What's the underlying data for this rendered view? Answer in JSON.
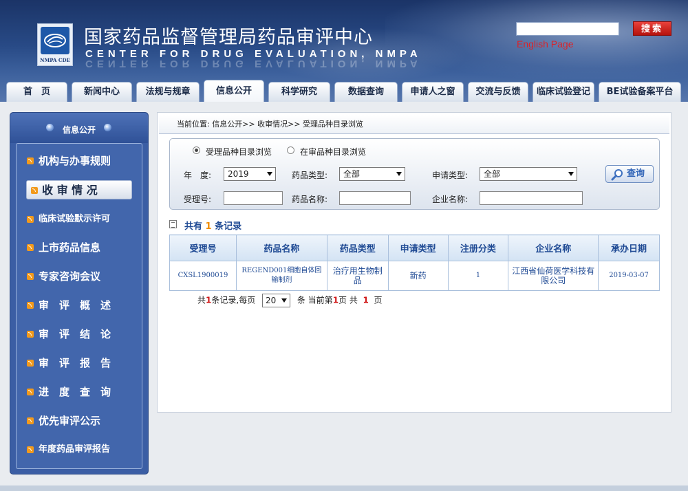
{
  "header": {
    "logo_text": "NMPA CDE",
    "title_cn": "国家药品监督管理局药品审评中心",
    "title_en": "CENTER FOR DRUG EVALUATION, NMPA",
    "search_button": "搜索",
    "search_placeholder": "",
    "english_link": "English Page"
  },
  "nav": {
    "tabs": [
      {
        "label": "首　页"
      },
      {
        "label": "新闻中心"
      },
      {
        "label": "法规与规章"
      },
      {
        "label": "信息公开",
        "active": true
      },
      {
        "label": "科学研究"
      },
      {
        "label": "数据查询"
      },
      {
        "label": "申请人之窗"
      },
      {
        "label": "交流与反馈"
      },
      {
        "label": "临床试验登记"
      },
      {
        "label": "BE试验备案平台"
      }
    ]
  },
  "sidebar": {
    "title": "信息公开",
    "items": [
      {
        "label": "机构与办事规则"
      },
      {
        "label": "收 审 情 况",
        "active": true
      },
      {
        "label": "临床试验默示许可"
      },
      {
        "label": "上市药品信息"
      },
      {
        "label": "专家咨询会议"
      },
      {
        "label": "审　评　概　述"
      },
      {
        "label": "审　评　结　论"
      },
      {
        "label": "审　评　报　告"
      },
      {
        "label": "进　度　查　询"
      },
      {
        "label": "优先审评公示"
      },
      {
        "label": "年度药品审评报告"
      }
    ]
  },
  "content": {
    "breadcrumb": "当前位置: 信息公开>> 收审情况>> 受理品种目录浏览",
    "filter": {
      "radio_1": "受理品种目录浏览",
      "radio_2": "在审品种目录浏览",
      "year_label": "年　度:",
      "year_value": "2019",
      "drug_type_label": "药品类型:",
      "drug_type_value": "全部",
      "apply_type_label": "申请类型:",
      "apply_type_value": "全部",
      "accept_no_label": "受理号:",
      "drug_name_label": "药品名称:",
      "company_label": "企业名称:",
      "query_button": "查询"
    },
    "result_count_prefix": "共有",
    "result_count_num": "1",
    "result_count_suffix": "条记录",
    "table": {
      "headers": [
        "受理号",
        "药品名称",
        "药品类型",
        "申请类型",
        "注册分类",
        "企业名称",
        "承办日期"
      ],
      "rows": [
        [
          "CXSL1900019",
          "REGEND001细胞自体回输制剂",
          "治疗用生物制品",
          "新药",
          "1",
          "江西省仙荷医学科技有限公司",
          "2019-03-07"
        ]
      ]
    },
    "pager": {
      "p1": "共",
      "total": "1",
      "p2": "条记录,每页",
      "per_page": "20",
      "p3": "条 当前第",
      "current": "1",
      "p4": "页 共",
      "pages": "1",
      "p5": "页"
    }
  }
}
